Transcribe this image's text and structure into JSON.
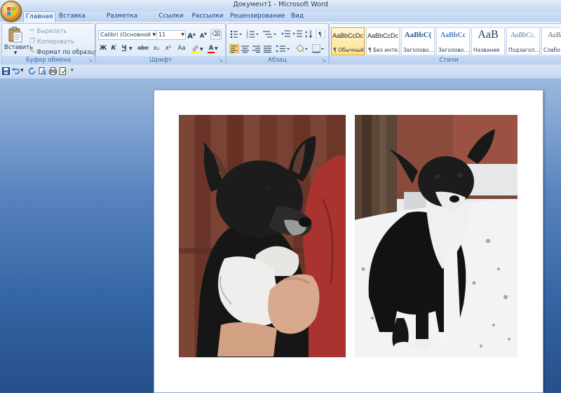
{
  "window": {
    "title": "Документ1 - Microsoft Word"
  },
  "tabs": [
    "Главная",
    "Вставка",
    "Разметка страницы",
    "Ссылки",
    "Рассылки",
    "Рецензирование",
    "Вид"
  ],
  "clipboard": {
    "label": "Буфер обмена",
    "paste": "Вставить",
    "cut": "Вырезать",
    "copy": "Копировать",
    "format_painter": "Формат по образцу"
  },
  "font": {
    "label": "Шрифт",
    "family": "Calibri (Основной текст)",
    "size": "11",
    "bold": "Ж",
    "italic": "К",
    "underline": "Ч",
    "strike": "abe",
    "subscript": "x₂",
    "superscript": "x²",
    "case": "Aa",
    "font_color": "A",
    "grow": "A",
    "shrink": "A"
  },
  "paragraph": {
    "label": "Абзац"
  },
  "styles": {
    "label": "Стили",
    "items": [
      {
        "sample": "AaBbCcDc",
        "name": "¶ Обычный"
      },
      {
        "sample": "AaBbCcDc",
        "name": "¶ Без инте..."
      },
      {
        "sample": "AaBbC(",
        "name": "Заголово..."
      },
      {
        "sample": "AaBbCc",
        "name": "Заголово..."
      },
      {
        "sample": "AaB",
        "name": "Название"
      },
      {
        "sample": "AaBbCc.",
        "name": "Подзагол..."
      },
      {
        "sample": "AaBbC",
        "name": "Слабо"
      }
    ]
  },
  "document": {
    "images": [
      "dog-photo-held",
      "dog-photo-snow"
    ]
  },
  "colors": {
    "accent": "#15428b",
    "highlight": "#ffff00",
    "font_color": "#ff0000"
  }
}
